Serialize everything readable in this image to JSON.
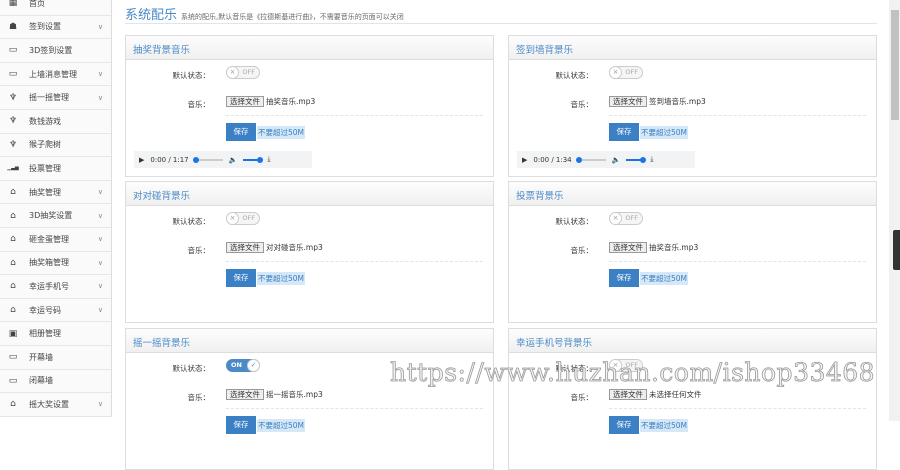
{
  "sidebar": {
    "items": [
      {
        "label": "首页",
        "icon": "home-icon",
        "chev": false
      },
      {
        "label": "签到设置",
        "icon": "users-icon",
        "chev": true
      },
      {
        "label": "3D签到设置",
        "icon": "monitor-icon",
        "chev": false
      },
      {
        "label": "上墙消息管理",
        "icon": "monitor-icon",
        "chev": true
      },
      {
        "label": "摇一摇管理",
        "icon": "trophy-icon",
        "chev": true
      },
      {
        "label": "数钱游戏",
        "icon": "trophy-icon",
        "chev": false
      },
      {
        "label": "猴子爬树",
        "icon": "trophy-icon",
        "chev": false
      },
      {
        "label": "投票管理",
        "icon": "signal-icon",
        "chev": false
      },
      {
        "label": "抽奖管理",
        "icon": "gift-icon",
        "chev": true
      },
      {
        "label": "3D抽奖设置",
        "icon": "gift-icon",
        "chev": true
      },
      {
        "label": "砸金蛋管理",
        "icon": "gift-icon",
        "chev": true
      },
      {
        "label": "抽奖箱管理",
        "icon": "gift-icon",
        "chev": true
      },
      {
        "label": "幸运手机号",
        "icon": "gift-icon",
        "chev": true
      },
      {
        "label": "幸运号码",
        "icon": "gift-icon",
        "chev": true
      },
      {
        "label": "相册管理",
        "icon": "image-icon",
        "chev": false
      },
      {
        "label": "开幕墙",
        "icon": "monitor-icon",
        "chev": false
      },
      {
        "label": "闭幕墙",
        "icon": "monitor-icon",
        "chev": false
      },
      {
        "label": "摇大奖设置",
        "icon": "gift-icon",
        "chev": true
      }
    ]
  },
  "header": {
    "title": "系统配乐",
    "desc": "系统的配乐,默认音乐是《拉德斯基进行曲》，不需要音乐的页面可以关闭"
  },
  "labels": {
    "status": "默认状态：",
    "music": "音乐：",
    "choose": "选择文件",
    "save": "保存",
    "hint": "不要超过50M",
    "off": "OFF",
    "on": "ON"
  },
  "panels": [
    {
      "title": "抽奖背景音乐",
      "state": "off",
      "file": "抽奖音乐.mp3",
      "audio": {
        "time": "0:00 / 1:17"
      }
    },
    {
      "title": "签到墙背景乐",
      "state": "off",
      "file": "签到墙音乐.mp3",
      "audio": {
        "time": "0:00 / 1:34"
      }
    },
    {
      "title": "对对碰背景乐",
      "state": "off",
      "file": "对对碰音乐.mp3"
    },
    {
      "title": "投票背景乐",
      "state": "off",
      "file": "抽奖音乐.mp3"
    },
    {
      "title": "摇一摇背景乐",
      "state": "on",
      "file": "摇一摇音乐.mp3"
    },
    {
      "title": "幸运手机号背景乐",
      "state": "off",
      "file": "未选择任何文件"
    }
  ],
  "watermark": "https://www.huzhan.com/ishop33468"
}
